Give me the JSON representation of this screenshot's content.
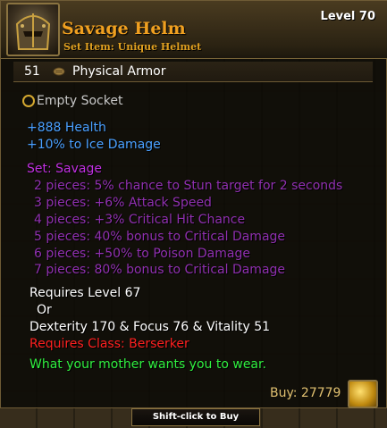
{
  "item": {
    "name": "Savage Helm",
    "subtitle": "Set Item: Unique Helmet",
    "level": "Level 70",
    "armor_value": "51",
    "armor_label": "Physical Armor",
    "socket_label": "Empty Socket"
  },
  "stats": [
    "+888 Health",
    "+10% to Ice Damage"
  ],
  "set": {
    "title": "Set: Savage",
    "bonuses": [
      "2 pieces: 5% chance to Stun target for 2 seconds",
      "3 pieces: +6% Attack Speed",
      "4 pieces: +3% Critical Hit Chance",
      "5 pieces: 40% bonus to Critical Damage",
      "6 pieces: +50% to Poison Damage",
      "7 pieces: 80% bonus to Critical Damage"
    ]
  },
  "requirements": {
    "level": "Requires Level 67",
    "or": "Or",
    "attributes": "Dexterity 170 & Focus 76 & Vitality 51",
    "class": "Requires Class: Berserker"
  },
  "flavor": "What your mother wants you to wear.",
  "buy": "Buy: 27779",
  "shift_click": "Shift-click to Buy",
  "icons": {
    "portrait": "helmet-icon",
    "armor": "armor-icon",
    "socket": "socket-icon",
    "gold": "gold-coins-icon"
  },
  "colors": {
    "name": "#f0a020",
    "stat": "#4aa0ff",
    "set": "#c030e0",
    "requirement_fail": "#ff2020",
    "flavor": "#30f040"
  }
}
